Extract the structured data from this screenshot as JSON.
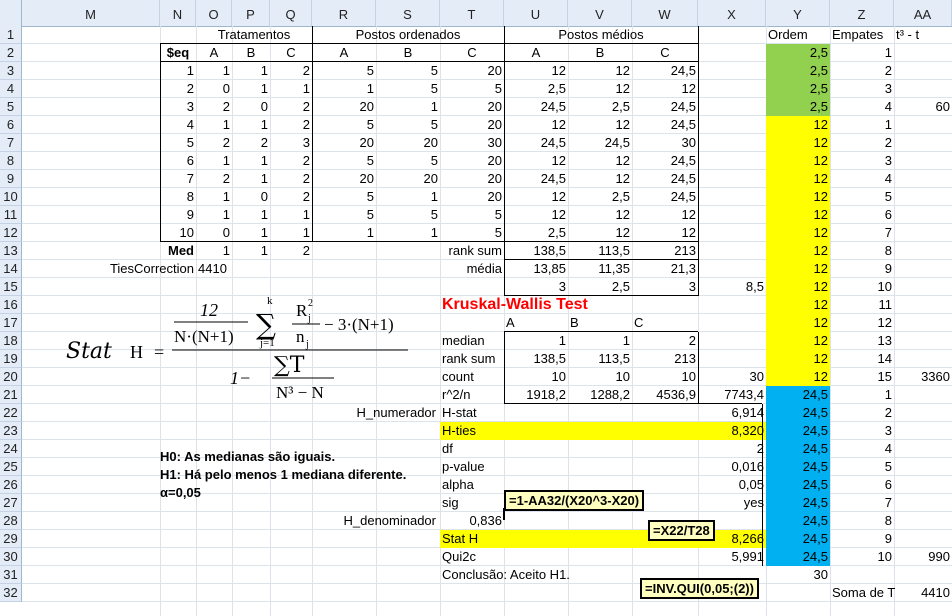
{
  "columns": [
    "M",
    "N",
    "O",
    "P",
    "Q",
    "R",
    "S",
    "T",
    "U",
    "V",
    "W",
    "X",
    "Y",
    "Z",
    "AA"
  ],
  "rows": [
    "1",
    "2",
    "3",
    "4",
    "5",
    "6",
    "7",
    "8",
    "9",
    "10",
    "11",
    "12",
    "13",
    "14",
    "15",
    "16",
    "17",
    "18",
    "19",
    "20",
    "21",
    "22",
    "23",
    "24",
    "25",
    "26",
    "27",
    "28",
    "29",
    "30",
    "31",
    "32"
  ],
  "headers": {
    "tratamentos": "Tratamentos",
    "postos_ordenados": "Postos ordenados",
    "postos_medios": "Postos médios",
    "ordem": "Ordem",
    "empates": "Empates",
    "t3t": "t³ - t"
  },
  "subheaders": [
    "$eq",
    "A",
    "B",
    "C",
    "A",
    "B",
    "C",
    "A",
    "B",
    "C"
  ],
  "data_rows": [
    [
      "1",
      "1",
      "1",
      "2",
      "5",
      "5",
      "20",
      "12",
      "12",
      "24,5"
    ],
    [
      "2",
      "0",
      "1",
      "1",
      "1",
      "5",
      "5",
      "2,5",
      "12",
      "12"
    ],
    [
      "3",
      "2",
      "0",
      "2",
      "20",
      "1",
      "20",
      "24,5",
      "2,5",
      "24,5"
    ],
    [
      "4",
      "1",
      "1",
      "2",
      "5",
      "5",
      "20",
      "12",
      "12",
      "24,5"
    ],
    [
      "5",
      "2",
      "2",
      "3",
      "20",
      "20",
      "30",
      "24,5",
      "24,5",
      "30"
    ],
    [
      "6",
      "1",
      "1",
      "2",
      "5",
      "5",
      "20",
      "12",
      "12",
      "24,5"
    ],
    [
      "7",
      "2",
      "1",
      "2",
      "20",
      "20",
      "20",
      "24,5",
      "12",
      "24,5"
    ],
    [
      "8",
      "1",
      "0",
      "2",
      "5",
      "1",
      "20",
      "12",
      "2,5",
      "24,5"
    ],
    [
      "9",
      "1",
      "1",
      "1",
      "5",
      "5",
      "5",
      "12",
      "12",
      "12"
    ],
    [
      "10",
      "0",
      "1",
      "1",
      "1",
      "1",
      "5",
      "2,5",
      "12",
      "12"
    ]
  ],
  "med_row": {
    "label": "Med",
    "o": "1",
    "p": "1",
    "q": "2",
    "t": "rank sum",
    "u": "138,5",
    "v": "113,5",
    "w": "213"
  },
  "ties_row": {
    "label": "TiesCorrection",
    "o": "4410",
    "t": "média",
    "u": "13,85",
    "v": "11,35",
    "w": "21,3"
  },
  "row15": {
    "u": "3",
    "v": "2,5",
    "w": "3",
    "x": "8,5"
  },
  "ordem": [
    "2,5",
    "2,5",
    "2,5",
    "2,5",
    "12",
    "12",
    "12",
    "12",
    "12",
    "12",
    "12",
    "12",
    "12",
    "12",
    "12",
    "12",
    "12",
    "12",
    "12",
    "24,5",
    "24,5",
    "24,5",
    "24,5",
    "24,5",
    "24,5",
    "24,5",
    "24,5",
    "24,5"
  ],
  "ordem_r30": "24,5",
  "ordem_r31": "30",
  "empates": [
    "1",
    "2",
    "3",
    "4",
    "1",
    "2",
    "3",
    "4",
    "5",
    "6",
    "7",
    "8",
    "9",
    "10",
    "11",
    "12",
    "13",
    "14",
    "15",
    "1",
    "2",
    "3",
    "4",
    "5",
    "6",
    "7",
    "8",
    "9",
    "10"
  ],
  "aa_values": {
    "r5": "60",
    "r20": "3360",
    "r30": "990"
  },
  "kw": {
    "title": "Kruskal-Wallis Test",
    "col_a": "A",
    "col_b": "B",
    "col_c": "C",
    "median_label": "median",
    "median": [
      "1",
      "1",
      "2"
    ],
    "ranksum_label": "rank sum",
    "ranksum": [
      "138,5",
      "113,5",
      "213"
    ],
    "count_label": "count",
    "count": [
      "10",
      "10",
      "10"
    ],
    "count_total": "30",
    "r2n_label": "r^2/n",
    "r2n": [
      "1918,2",
      "1288,2",
      "4536,9"
    ],
    "r2n_total": "7743,4",
    "hstat_label": "H-stat",
    "hstat": "6,914",
    "hties_label": "H-ties",
    "hties": "8,320",
    "df_label": "df",
    "df": "2",
    "pvalue_label": "p-value",
    "pvalue": "0,016",
    "alpha_label": "alpha",
    "alpha": "0,05",
    "sig_label": "sig",
    "sig": "yes",
    "stath_label": "Stat H",
    "stath": "8,266",
    "quic_label": "Qui2c",
    "quic": "5,991",
    "conclusao": "Conclusão: Aceito H1."
  },
  "h_numerador": "H_numerador",
  "h_denominador": "H_denominador",
  "h_denominador_val": "0,836",
  "hypotheses": {
    "h0": "H0: As medianas são iguais.",
    "h1": "H1: Há pelo menos 1 mediana diferente.",
    "alpha": "α=0,05"
  },
  "formula": {
    "stat_label": "Stat",
    "h": "H",
    "eq": "=",
    "twelve": "12",
    "n_np1": "N·(N+1)",
    "sum": "∑",
    "k": "k",
    "j1": "j=1",
    "rj2": "R",
    "rj_sup": "2",
    "rj_sub": "j",
    "nj": "n",
    "nj_sub": "j",
    "minus3": "− 3·(N+1)",
    "one_minus": "1−",
    "sumT": "∑T",
    "n3_n": "N³ − N"
  },
  "tooltips": {
    "t1": "=1-AA32/(X20^3-X20)",
    "t2": "=X22/T28",
    "t3": "=INV.QUI(0,05;(2))"
  },
  "soma_de_t_label": "Soma de T",
  "soma_de_t": "4410"
}
